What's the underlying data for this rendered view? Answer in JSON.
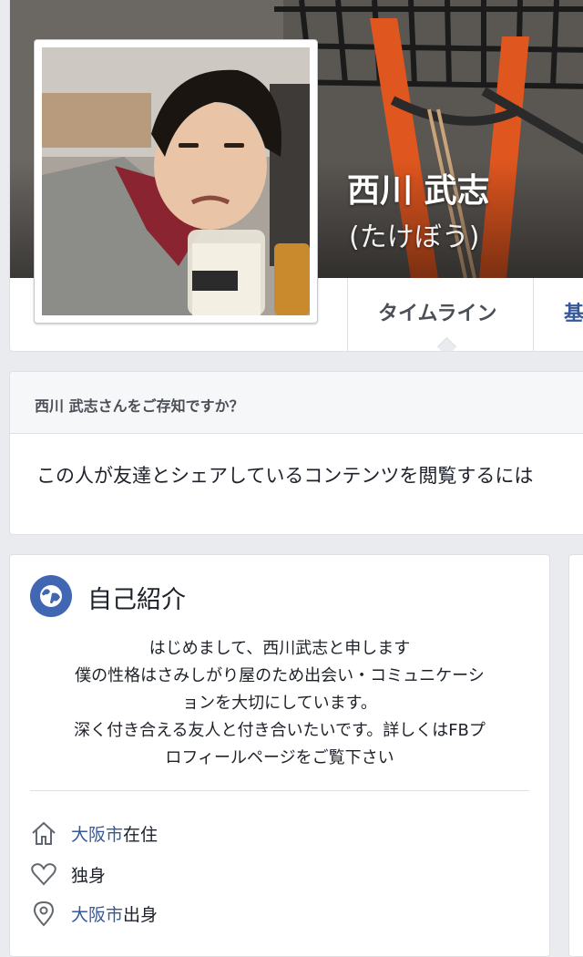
{
  "profile": {
    "name": "西川 武志",
    "alternate_name": "(たけぼう)"
  },
  "tabs": [
    {
      "label": "タイムライン",
      "active": true
    },
    {
      "label": "基"
    }
  ],
  "know_prompt": {
    "title": "西川 武志さんをご存知ですか？",
    "body": "この人が友達とシェアしているコンテンツを閲覧するには"
  },
  "intro": {
    "title": "自己紹介",
    "bio_lines": [
      "はじめまして、西川武志と申します",
      "僕の性格はさみしがり屋のため出会い・コミュニケーシ",
      "ョンを大切にしています。",
      "深く付き合える友人と付き合いたいです。詳しくはFBプ",
      "ロフィールページをご覧下さい"
    ],
    "items": [
      {
        "icon": "home-icon",
        "link": "大阪市",
        "suffix": "在住"
      },
      {
        "icon": "heart-icon",
        "link": "",
        "suffix": "独身"
      },
      {
        "icon": "location-pin-icon",
        "link": "大阪市",
        "suffix": "出身"
      }
    ]
  },
  "colors": {
    "page_bg": "#e9ebee",
    "link": "#365899",
    "accent": "#4267b2"
  }
}
